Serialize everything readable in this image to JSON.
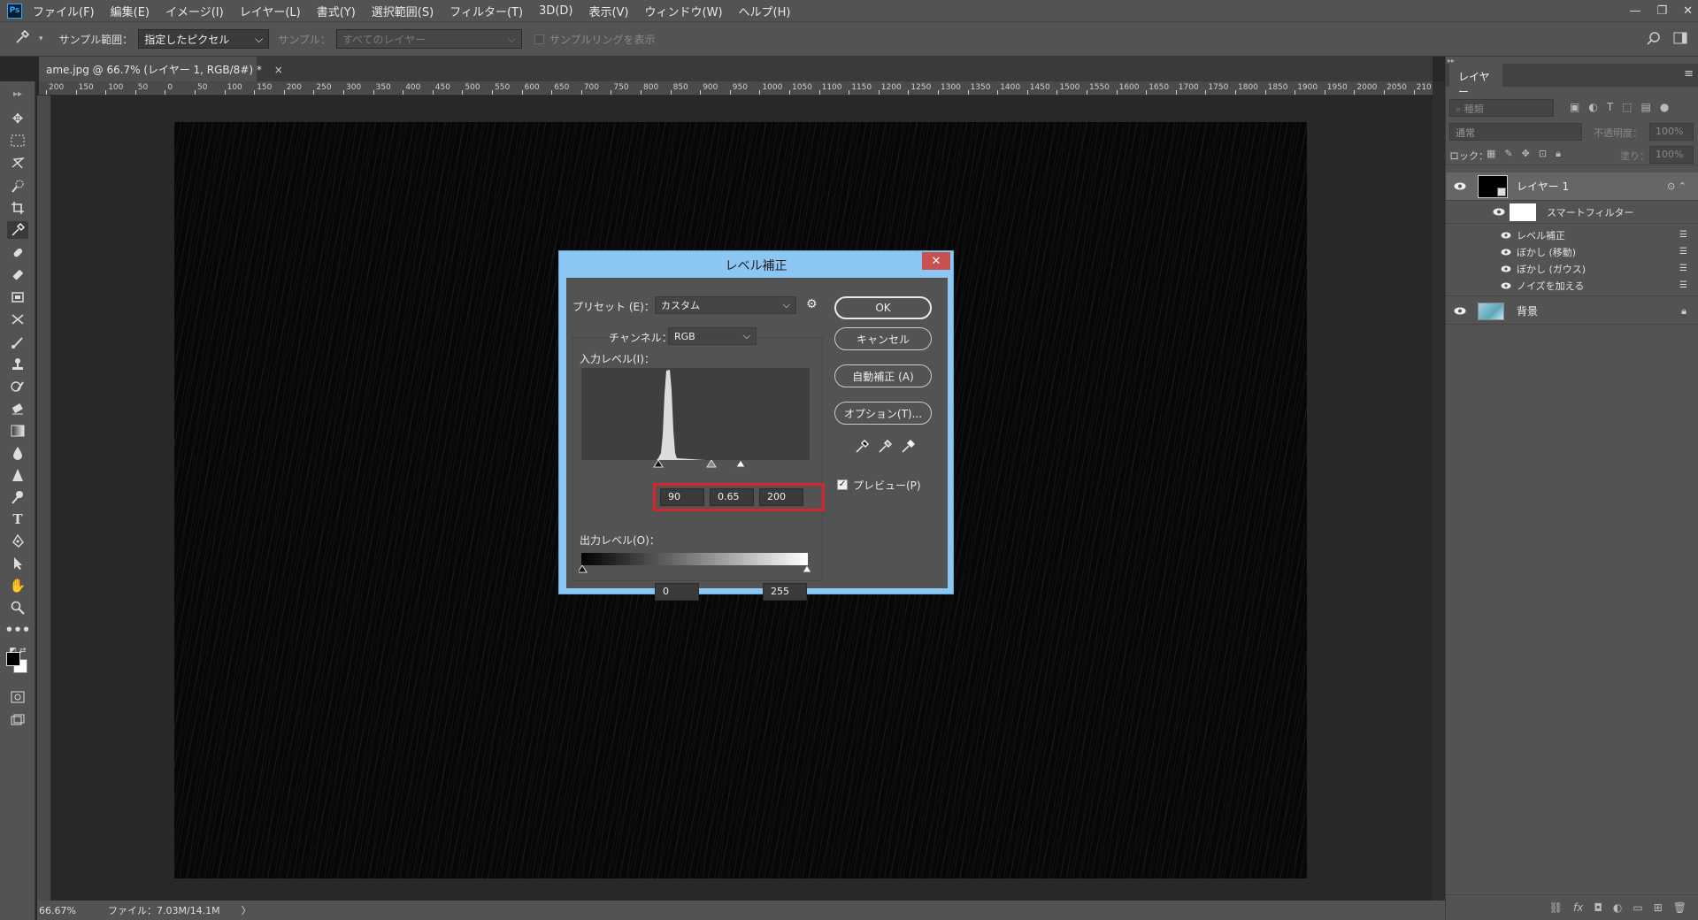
{
  "menubar": {
    "logo": "Ps",
    "items": [
      "ファイル(F)",
      "編集(E)",
      "イメージ(I)",
      "レイヤー(L)",
      "書式(Y)",
      "選択範囲(S)",
      "フィルター(T)",
      "3D(D)",
      "表示(V)",
      "ウィンドウ(W)",
      "ヘルプ(H)"
    ]
  },
  "options": {
    "sample_size_label": "サンプル範囲：",
    "sample_size_value": "指定したピクセル",
    "sample_label": "サンプル：",
    "sample_value": "すべてのレイヤー",
    "show_ring_label": "サンプルリングを表示"
  },
  "document": {
    "tab_title": "ame.jpg @ 66.7% (レイヤー 1, RGB/8#) *",
    "close": "×"
  },
  "ruler_ticks": [
    "200",
    "150",
    "100",
    "50",
    "0",
    "50",
    "100",
    "150",
    "200",
    "250",
    "300",
    "350",
    "400",
    "450",
    "500",
    "550",
    "600",
    "650",
    "700",
    "750",
    "800",
    "850",
    "900",
    "950",
    "1000",
    "1050",
    "1100",
    "1150",
    "1200",
    "1250",
    "1300",
    "1350",
    "1400",
    "1450",
    "1500",
    "1550",
    "1600",
    "1650",
    "1700",
    "1750",
    "1800",
    "1850",
    "1900",
    "1950",
    "2000",
    "2050",
    "210"
  ],
  "status": {
    "zoom": "66.67%",
    "file_info": "ファイル：7.03M/14.1M",
    "arrow": "〉"
  },
  "dialog": {
    "title": "レベル補正",
    "close": "✕",
    "preset_label": "プリセット (E)：",
    "preset_value": "カスタム",
    "channel_label": "チャンネル：",
    "channel_value": "RGB",
    "input_label": "入力レベル(I)：",
    "input_black": "90",
    "input_gamma": "0.65",
    "input_white": "200",
    "output_label": "出力レベル(O)：",
    "output_black": "0",
    "output_white": "255",
    "ok": "OK",
    "cancel": "キャンセル",
    "auto": "自動補正 (A)",
    "options": "オプション(T)...",
    "preview": "プレビュー(P)",
    "preview_checked": true
  },
  "layers_panel": {
    "tab": "レイヤー",
    "kind_placeholder": "種類",
    "blend_mode": "通常",
    "opacity_label": "不透明度：",
    "opacity_value": "100%",
    "lock_label": "ロック：",
    "fill_label": "塗り：",
    "fill_value": "100%",
    "layer1_name": "レイヤー 1",
    "smart_filter_label": "スマートフィルター",
    "filters": [
      "レベル補正",
      "ぼかし (移動)",
      "ぼかし (ガウス)",
      "ノイズを加える"
    ],
    "background_name": "背景"
  },
  "colors": {
    "chrome": "#535353",
    "canvas_bg": "#282828",
    "dialog_frame": "#8cc6f3",
    "highlight": "#d9232d",
    "close_red": "#c75050"
  }
}
